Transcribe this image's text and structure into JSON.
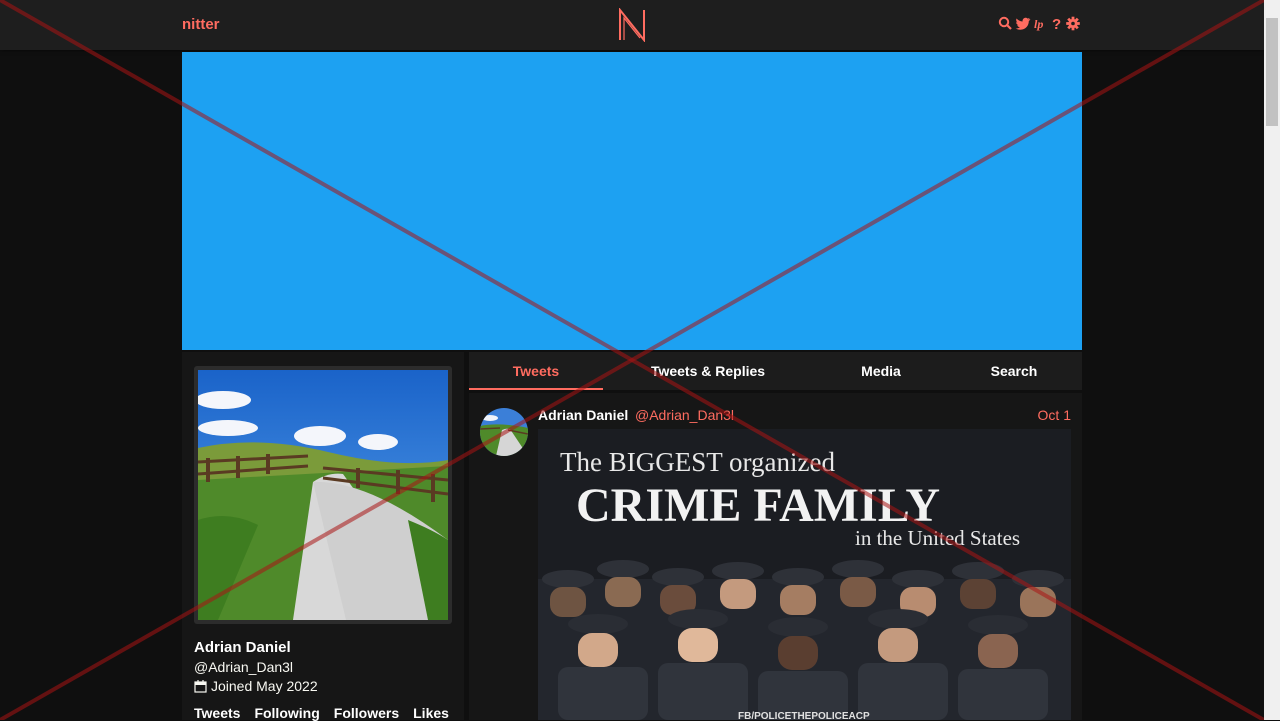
{
  "nav": {
    "logo_text": "nitter",
    "icons": [
      "search-icon",
      "twitter-bird-icon",
      "lp-icon",
      "help-icon",
      "gear-icon"
    ]
  },
  "colors": {
    "accent": "#ff6c60",
    "banner": "#1da1f2",
    "background": "#0f0f0f",
    "panel": "#161616"
  },
  "profile": {
    "fullname": "Adrian Daniel",
    "username": "@Adrian_Dan3l",
    "joined": "Joined May 2022",
    "stats": [
      "Tweets",
      "Following",
      "Followers",
      "Likes"
    ]
  },
  "tabs": [
    {
      "label": "Tweets",
      "active": true
    },
    {
      "label": "Tweets & Replies",
      "active": false
    },
    {
      "label": "Media",
      "active": false
    },
    {
      "label": "Search",
      "active": false
    }
  ],
  "tweet": {
    "fullname": "Adrian Daniel",
    "username": "@Adrian_Dan3l",
    "date": "Oct 1",
    "image_text": {
      "line1": "The BIGGEST organized",
      "line2": "CRIME FAMILY",
      "line3": "in the United States",
      "watermark": "FB/POLICETHEPOLICEACP"
    }
  }
}
